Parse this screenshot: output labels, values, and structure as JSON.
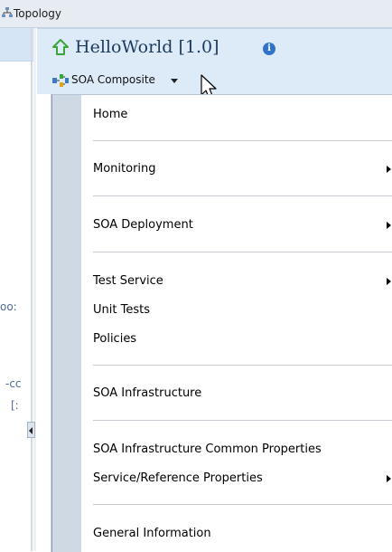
{
  "topbar": {
    "title": "Topology"
  },
  "left_panel": {
    "fragments": [
      "oo:",
      "-cc",
      "[:"
    ]
  },
  "header": {
    "title": "HelloWorld [1.0]",
    "info_icon": "info-icon",
    "composite_label": "SOA Composite"
  },
  "menu": {
    "items": [
      {
        "label": "Home",
        "has_submenu": false
      },
      {
        "label": "Monitoring",
        "has_submenu": true
      },
      {
        "label": "SOA Deployment",
        "has_submenu": true
      },
      {
        "label": "Test Service",
        "has_submenu": true
      },
      {
        "label": "Unit Tests",
        "has_submenu": false
      },
      {
        "label": "Policies",
        "has_submenu": false
      },
      {
        "label": "SOA Infrastructure",
        "has_submenu": false
      },
      {
        "label": "SOA Infrastructure Common Properties",
        "has_submenu": false
      },
      {
        "label": "Service/Reference Properties",
        "has_submenu": true
      },
      {
        "label": "General Information",
        "has_submenu": false
      }
    ]
  },
  "colors": {
    "header_bg": "#ddebf9",
    "menu_gutter": "#cfd9e3",
    "title_text": "#1a3a5e",
    "home_icon": "#3aa637"
  }
}
